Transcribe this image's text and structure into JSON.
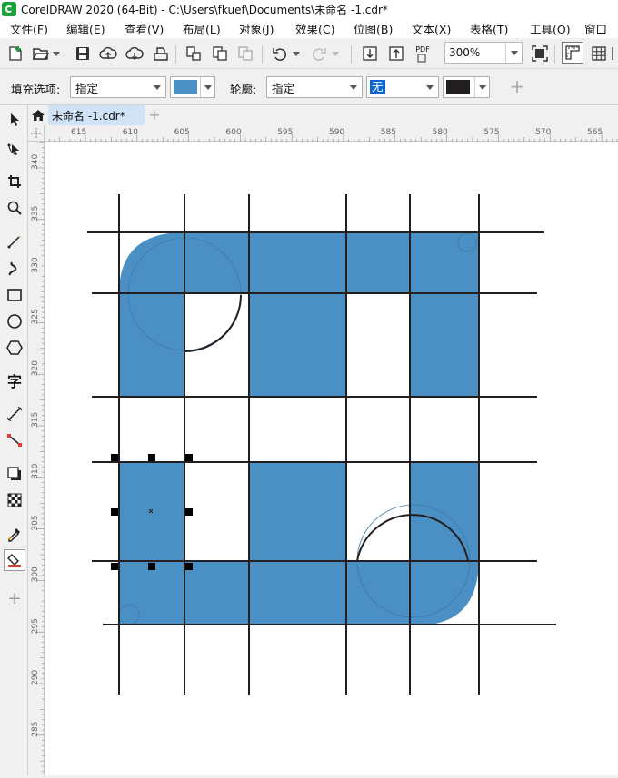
{
  "window": {
    "title": "CorelDRAW 2020 (64-Bit) - C:\\Users\\fkuef\\Documents\\未命名 -1.cdr*"
  },
  "menu": [
    "文件(F)",
    "编辑(E)",
    "查看(V)",
    "布局(L)",
    "对象(J)",
    "效果(C)",
    "位图(B)",
    "文本(X)",
    "表格(T)",
    "工具(O)",
    "窗口"
  ],
  "toolbar": {
    "zoom_value": "300%",
    "pdf_label": "PDF"
  },
  "property_bar": {
    "fill_label": "填充选项:",
    "fill_value": "指定",
    "fill_color": "#4a90c4",
    "outline_label": "轮廓:",
    "outline_value": "指定",
    "outline_width": "无",
    "outline_color": "#231f20"
  },
  "tabs": {
    "document_tab": "未命名 -1.cdr*"
  },
  "rulers": {
    "horizontal": [
      "615",
      "610",
      "605",
      "600",
      "595",
      "590",
      "585",
      "580",
      "575",
      "570",
      "565"
    ],
    "vertical": [
      "340",
      "335",
      "330",
      "325",
      "320",
      "315",
      "310",
      "305",
      "300",
      "295",
      "290",
      "285"
    ]
  },
  "colors": {
    "shape_fill": "#4a90c4",
    "line": "#231f20",
    "selection": "#000000",
    "tab_active": "#cfe2f6"
  }
}
